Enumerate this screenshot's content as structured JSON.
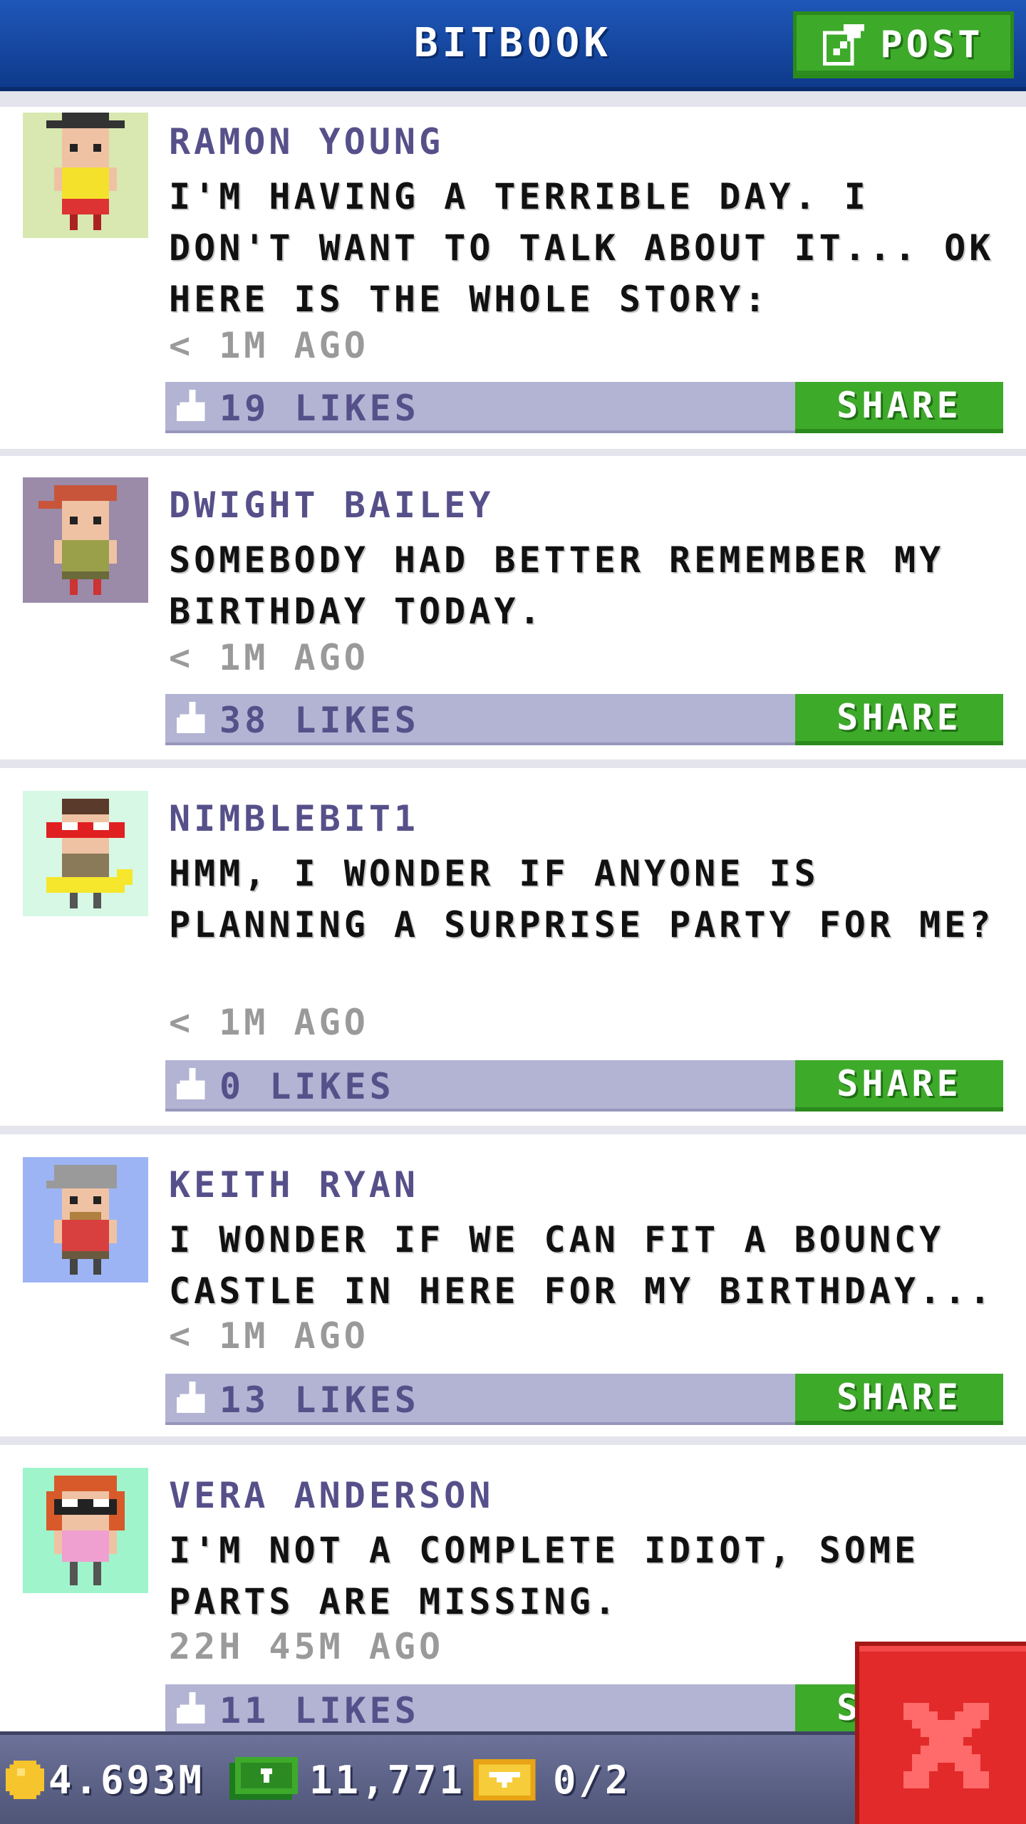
{
  "header": {
    "title": "BITBOOK",
    "post_label": "POST"
  },
  "posts": [
    {
      "username": "RAMON YOUNG",
      "message": "I'M HAVING A TERRIBLE DAY. I DON'T WANT TO TALK ABOUT IT...  OK HERE IS THE WHOLE STORY:",
      "time": "< 1M AGO",
      "likes": "19 LIKES",
      "share_label": "SHARE",
      "avatar_bg": "#d8e8b0"
    },
    {
      "username": "DWIGHT BAILEY",
      "message": "SOMEBODY HAD BETTER REMEMBER MY BIRTHDAY TODAY.",
      "time": "< 1M AGO",
      "likes": "38 LIKES",
      "share_label": "SHARE",
      "avatar_bg": "#9b8aa8"
    },
    {
      "username": "NIMBLEBIT1",
      "message": "HMM, I WONDER IF ANYONE IS PLANNING A SURPRISE PARTY FOR ME?",
      "time": "< 1M AGO",
      "likes": "0 LIKES",
      "share_label": "SHARE",
      "avatar_bg": "#d6f8e4"
    },
    {
      "username": "KEITH RYAN",
      "message": "I WONDER IF WE CAN FIT A BOUNCY CASTLE IN HERE FOR MY BIRTHDAY...",
      "time": "< 1M AGO",
      "likes": "13 LIKES",
      "share_label": "SHARE",
      "avatar_bg": "#9db4f4"
    },
    {
      "username": "VERA ANDERSON",
      "message": "I'M NOT A COMPLETE IDIOT, SOME PARTS ARE MISSING.",
      "time": "22H 45M AGO",
      "likes": "11 LIKES",
      "share_label": "SHARE",
      "avatar_bg": "#a0f4cc"
    }
  ],
  "status": {
    "coins": "4.693M",
    "bux": "11,771",
    "tickets": "0/2"
  },
  "colors": {
    "header": "#1f57b9",
    "accent_green": "#3eaa2a",
    "likes_bar": "#b3b3d3",
    "close_red": "#e22a2a"
  }
}
